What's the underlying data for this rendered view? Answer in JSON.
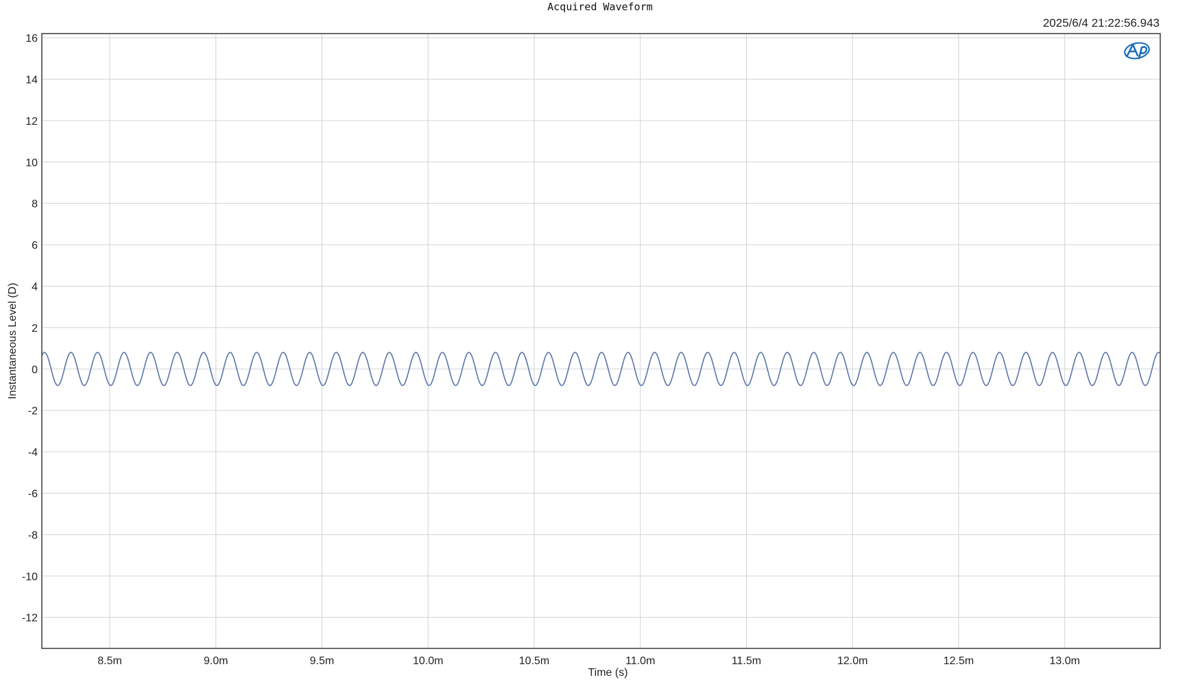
{
  "chart_data": {
    "type": "line",
    "title": "Acquired Waveform",
    "timestamp": "2025/6/4 21:22:56.943",
    "xlabel": "Time (s)",
    "ylabel": "Instantaneous Level (D)",
    "xlim": [
      0.00818,
      0.01345
    ],
    "ylim": [
      -13.5,
      16.2
    ],
    "x_ticks": [
      0.0085,
      0.009,
      0.0095,
      0.01,
      0.0105,
      0.011,
      0.0115,
      0.012,
      0.0125,
      0.013
    ],
    "x_tick_labels": [
      "8.5m",
      "9.0m",
      "9.5m",
      "10.0m",
      "10.5m",
      "11.0m",
      "11.5m",
      "12.0m",
      "12.5m",
      "13.0m"
    ],
    "y_ticks": [
      16,
      14,
      12,
      10,
      8,
      6,
      4,
      2,
      0,
      -2,
      -4,
      -6,
      -8,
      -10,
      -12
    ],
    "y_tick_labels": [
      "16",
      "14",
      "12",
      "10",
      "8",
      "6",
      "4",
      "2",
      "0",
      "-2",
      "-4",
      "-6",
      "-8",
      "-10",
      "-12"
    ],
    "grid": true,
    "series": [
      {
        "waveform": "sine",
        "amplitude": 0.8,
        "frequency_hz": 8000,
        "phase_at_xmin_cycles": 0.15,
        "color": "#5b74a8"
      }
    ],
    "logo": "ap-logo"
  },
  "colors": {
    "grid": "#cfd3d8",
    "frame": "#3a3a3a",
    "logo": "#1d6fb8"
  }
}
